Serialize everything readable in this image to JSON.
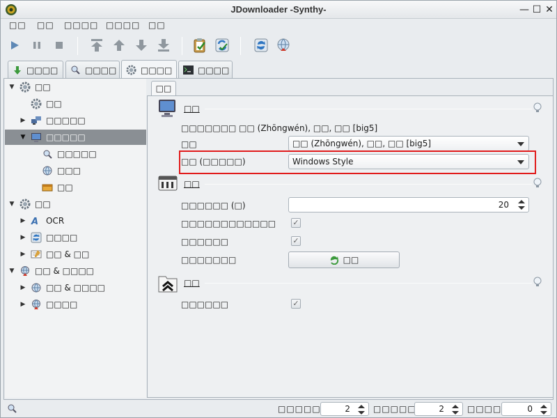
{
  "window": {
    "title": "JDownloader -Synthy-"
  },
  "menu": [
    "□□",
    "□□",
    "□□□□",
    "□□□□",
    "□□"
  ],
  "toolbar": {
    "buttons": [
      {
        "icon": "play-icon"
      },
      {
        "icon": "pause-icon"
      },
      {
        "icon": "stop-icon"
      },
      {
        "icon": "move-top-icon"
      },
      {
        "icon": "move-up-icon"
      },
      {
        "icon": "move-down-icon"
      },
      {
        "icon": "move-bottom-icon"
      },
      {
        "icon": "clipboard-check-icon"
      },
      {
        "icon": "reconnect-check-icon"
      },
      {
        "icon": "refresh-icon"
      },
      {
        "icon": "reconnect-globe-icon"
      }
    ]
  },
  "tabs": [
    {
      "label": "□□□□",
      "icon": "download-arrow-icon"
    },
    {
      "label": "□□□□",
      "icon": "linkgrabber-search-icon"
    },
    {
      "label": "□□□□",
      "icon": "gear-icon",
      "active": true
    },
    {
      "label": "□□□□",
      "icon": "log-console-icon"
    }
  ],
  "tree": [
    {
      "label": "□□",
      "indent": 0,
      "arrow": "▼",
      "icon": "gear-icon"
    },
    {
      "label": "□□",
      "indent": 1,
      "arrow": "",
      "icon": "gear-icon"
    },
    {
      "label": "□□□□□",
      "indent": 1,
      "arrow": "▶",
      "icon": "network-icon"
    },
    {
      "label": "□□□□□",
      "indent": 1,
      "arrow": "▼",
      "icon": "monitor-icon",
      "selected": true
    },
    {
      "label": "□□□□□",
      "indent": 2,
      "arrow": "",
      "icon": "linkgrabber-search-icon"
    },
    {
      "label": "□□□",
      "indent": 2,
      "arrow": "",
      "icon": "globe-icon"
    },
    {
      "label": "□□",
      "indent": 2,
      "arrow": "",
      "icon": "archive-box-icon"
    },
    {
      "label": "□□",
      "indent": 0,
      "arrow": "▼",
      "icon": "gear-icon"
    },
    {
      "label": "OCR",
      "indent": 1,
      "arrow": "▶",
      "icon": "ocr-icon"
    },
    {
      "label": "□□□□",
      "indent": 1,
      "arrow": "▶",
      "icon": "refresh-icon"
    },
    {
      "label": "□□ & □□",
      "indent": 1,
      "arrow": "▶",
      "icon": "notepad-icon"
    },
    {
      "label": "□□ & □□□□",
      "indent": 0,
      "arrow": "▼",
      "icon": "globe-gear-icon"
    },
    {
      "label": "□□ & □□□□",
      "indent": 1,
      "arrow": "▶",
      "icon": "globe-icon"
    },
    {
      "label": "□□□□",
      "indent": 1,
      "arrow": "▶",
      "icon": "globe-gear-icon"
    }
  ],
  "subtab": "□□",
  "sections": {
    "display": {
      "title": "□□",
      "language_info": "□□□□□□□ □□ (Zhōngwén), □□, □□ [big5]",
      "language_label": "□□",
      "language_value": "□□ (Zhōngwén), □□, □□ [big5]",
      "style_label": "□□ (□□□□□)",
      "style_value": "Windows Style"
    },
    "controls": {
      "title": "□□",
      "spinner_label": "□□□□□□ (□)",
      "spinner_value": "20",
      "check1_label": "□□□□□□□□□□□□",
      "check2_label": "□□□□□□",
      "button_row_label": "□□□□□□□",
      "button_label": "□□"
    },
    "misc": {
      "title": "□□",
      "check_label": "□□□□□□"
    }
  },
  "status": {
    "label1": "□□□□□",
    "value1": "2",
    "label2": "□□□□□",
    "value2": "2",
    "label3": "□□□□",
    "value3": "0"
  },
  "colors": {
    "highlight": "#e11b1b",
    "tree_selected": "#8a8f94"
  }
}
